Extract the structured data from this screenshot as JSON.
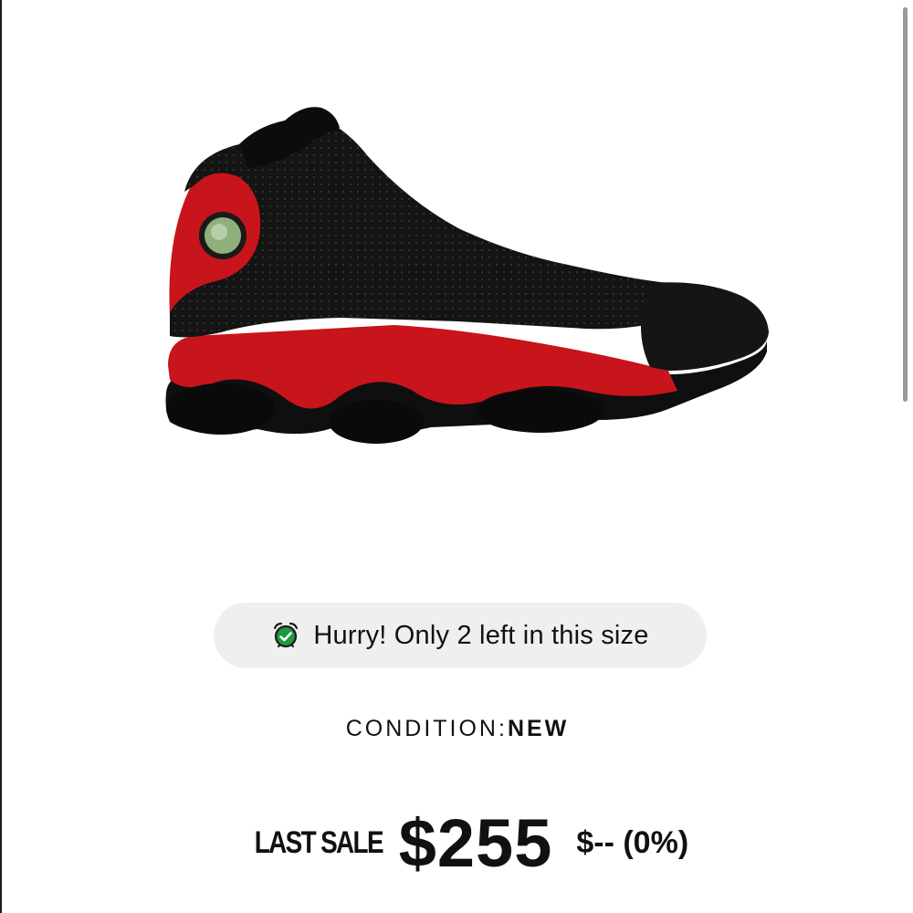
{
  "product": {
    "image_alt": "Air Jordan 13 sneaker, black and red",
    "image_icon": "sneaker-image"
  },
  "stock_alert": {
    "icon": "alarm-clock-icon",
    "icon_color": "#1a9a3a",
    "text": "Hurry! Only 2 left in this size"
  },
  "condition": {
    "label": "CONDITION:",
    "value": "NEW"
  },
  "last_sale": {
    "label": "LAST SALE",
    "price": "$255",
    "change": "$-- (0%)"
  },
  "colors": {
    "pill_background": "#efefef",
    "text": "#111111",
    "shoe_red": "#c8141b",
    "shoe_black": "#111111"
  }
}
